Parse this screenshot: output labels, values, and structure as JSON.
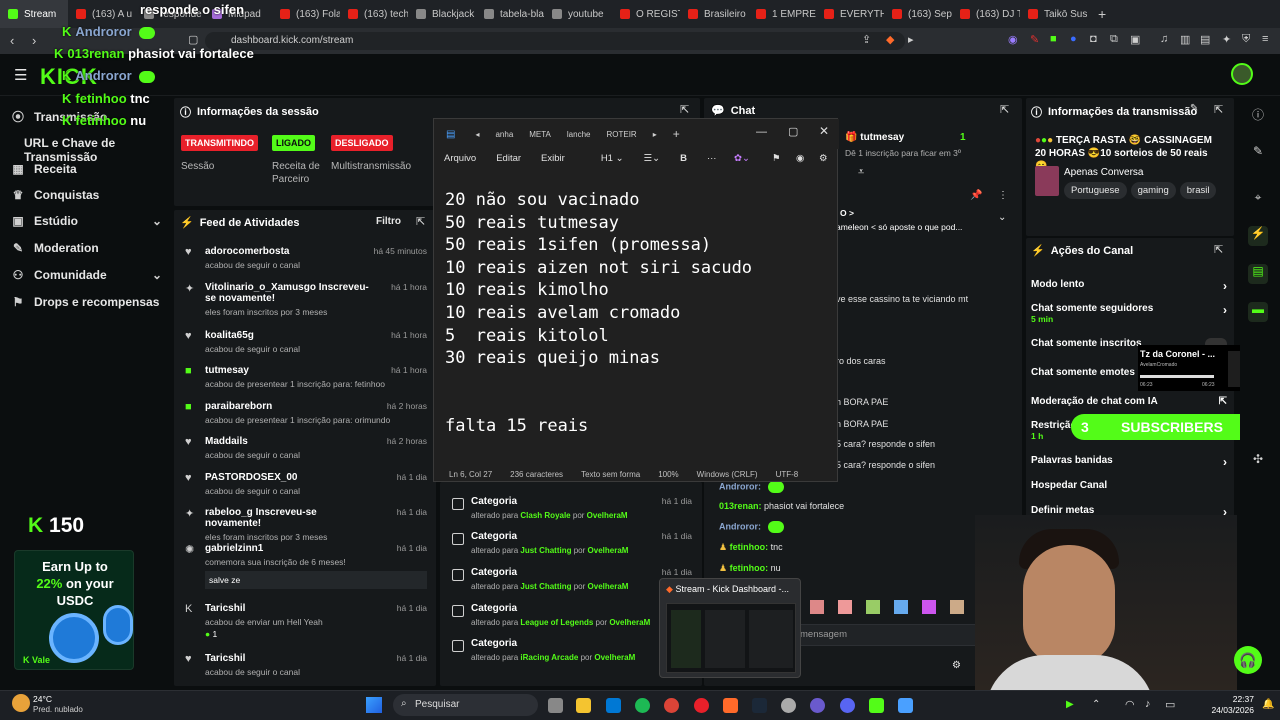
{
  "browser": {
    "tabs": [
      {
        "label": "Stream",
        "fav": "kick",
        "active": true
      },
      {
        "label": "(163) A u",
        "fav": "yt"
      },
      {
        "label": "responde o sifen",
        "fav": "g"
      },
      {
        "label": "Midpad",
        "fav": "p"
      },
      {
        "label": "(163) Fola",
        "fav": "yt"
      },
      {
        "label": "(163) tech",
        "fav": "yt"
      },
      {
        "label": "Blackjack",
        "fav": "g"
      },
      {
        "label": "tabela-bla",
        "fav": "g"
      },
      {
        "label": "youtube",
        "fav": "g"
      },
      {
        "label": "O REGISTI",
        "fav": "yt"
      },
      {
        "label": "Brasileiro",
        "fav": "yt"
      },
      {
        "label": "1 EMPREE",
        "fav": "yt"
      },
      {
        "label": "EVERYTHI",
        "fav": "yt"
      },
      {
        "label": "(163) Sep",
        "fav": "yt"
      },
      {
        "label": "(163) DJ T",
        "fav": "yt"
      },
      {
        "label": "Taikō Susi",
        "fav": "yt"
      }
    ],
    "url": "dashboard.kick.com/stream"
  },
  "overlay_chat": [
    {
      "name": "",
      "text": "responde o sifen"
    },
    {
      "name": "Androror",
      "text": ""
    },
    {
      "name": "013renan",
      "text": "phasiot vai fortalece"
    },
    {
      "name": "Androror",
      "text": ""
    },
    {
      "name": "fetinhoo",
      "text": "tnc"
    },
    {
      "name": "fetinhoo",
      "text": "nu"
    }
  ],
  "header": {
    "logo": "KICK"
  },
  "sidebar": {
    "items": [
      {
        "label": "Transmissão",
        "icon": "broadcast-icon"
      },
      {
        "label": "URL e Chave de Transmissão",
        "icon": ""
      },
      {
        "label": "Receita",
        "icon": "chart-icon"
      },
      {
        "label": "Conquistas",
        "icon": "trophy-icon"
      },
      {
        "label": "Estúdio",
        "icon": "studio-icon",
        "chevron": true
      },
      {
        "label": "Moderation",
        "icon": "wrench-icon"
      },
      {
        "label": "Comunidade",
        "icon": "community-icon",
        "chevron": true
      },
      {
        "label": "Drops e recompensas",
        "icon": "gift-icon"
      }
    ],
    "points": "150",
    "promo": {
      "l1": "Earn Up to",
      "l2": "22%",
      "l3": "on your",
      "l4": "USDC",
      "vale": "Vale"
    }
  },
  "session": {
    "title": "Informações da sessão",
    "statuses": [
      {
        "badge": "TRANSMITINDO",
        "label": "Sessão",
        "color": "#e8202a"
      },
      {
        "badge": "LIGADO",
        "label": "Receita de Parceiro",
        "color": "#53fc18"
      },
      {
        "badge": "DESLIGADO",
        "label": "Multistransmissão",
        "color": "#e8202a"
      }
    ]
  },
  "feed": {
    "title": "Feed de Atividades",
    "filter": "Filtro",
    "items": [
      {
        "name": "adorocomerbosta",
        "desc": "acabou de seguir o canal",
        "time": "há 45 minutos",
        "icon": "heart-icon"
      },
      {
        "name": "Vitolinario_o_Xamusgo Inscreveu-se novamente!",
        "desc": "eles foram inscritos por 3 meses",
        "time": "há 1 hora",
        "icon": "star-icon"
      },
      {
        "name": "koalita65g",
        "desc": "acabou de seguir o canal",
        "time": "há 1 hora",
        "icon": "heart-icon"
      },
      {
        "name": "tutmesay",
        "desc": "acabou de presentear 1 inscrição para: fetinhoo",
        "time": "há 1 hora",
        "icon": "gift-icon"
      },
      {
        "name": "paraibareborn",
        "desc": "acabou de presentear 1 inscrição para: orimundo",
        "time": "há 2 horas",
        "icon": "gift-icon"
      },
      {
        "name": "Maddails",
        "desc": "acabou de seguir o canal",
        "time": "há 2 horas",
        "icon": "heart-icon"
      },
      {
        "name": "PASTORDOSEX_00",
        "desc": "acabou de seguir o canal",
        "time": "há 1 dia",
        "icon": "heart-icon"
      },
      {
        "name": "rabeloo_g Inscreveu-se novamente!",
        "desc": "eles foram inscritos por 3 meses",
        "time": "há 1 dia",
        "icon": "star-icon"
      },
      {
        "name": "gabrielzinn1",
        "desc": "comemora sua inscrição de 6 meses!",
        "time": "há 1 dia",
        "icon": "party-icon",
        "note": "salve ze"
      },
      {
        "name": "Taricshil",
        "desc": "acabou de enviar um Hell Yeah",
        "time": "há 1 dia",
        "icon": "kick-icon",
        "extra": "1"
      },
      {
        "name": "Taricshil",
        "desc": "acabou de seguir o canal",
        "time": "há 1 dia",
        "icon": "heart-icon"
      }
    ]
  },
  "notepad": {
    "tabs": [
      "anha",
      "META",
      "lanche",
      "ROTEIR"
    ],
    "menu": [
      "Arquivo",
      "Editar",
      "Exibir"
    ],
    "heading": "H1",
    "lines": [
      "20 não sou vacinado",
      "50 reais tutmesay",
      "50 reais 1sifen (promessa)",
      "10 reais aizen not siri sacudo",
      "10 reais kimolho",
      "10 reais avelam cromado",
      "5  reais kitolol",
      "30 reais queijo minas",
      "",
      "",
      "falta 15 reais"
    ],
    "status": [
      "Ln 6, Col 27",
      "236 caracteres",
      "Texto sem forma",
      "100%",
      "Windows (CRLF)",
      "UTF-8"
    ]
  },
  "categories": [
    {
      "title": "Categoria",
      "game": "Clash Royale",
      "by": "OvelheraM",
      "time": "há 1 dia"
    },
    {
      "title": "Categoria",
      "game": "Just Chatting",
      "by": "OvelheraM",
      "time": "há 1 dia"
    },
    {
      "title": "Categoria",
      "game": "Just Chatting",
      "by": "OvelheraM",
      "time": "há 1 dia"
    },
    {
      "title": "Categoria",
      "game": "League of Legends",
      "by": "OvelheraM",
      "time": "há 1 dia"
    },
    {
      "title": "Categoria",
      "game": "iRacing Arcade",
      "by": "OvelheraM",
      "time": "há 1 dia"
    }
  ],
  "category_sub_prefix": "alterado para",
  "category_by_prefix": "por",
  "chat": {
    "title": "Chat",
    "top_user": "tutmesay",
    "top_user_count": "1",
    "top_sub": "Dê 1 inscrição para ficar em 3º",
    "pinned": "ameleon < só aposte o que pod...",
    "lines": [
      {
        "name": "",
        "text": "ve esse cassino ta te viciando mt"
      },
      {
        "name": "",
        "text": "ro dos caras"
      },
      {
        "name": "",
        "text": "n BORA PAE"
      },
      {
        "name": "",
        "text": "n BORA PAE"
      },
      {
        "name": "",
        "text": "5 cara? responde o sifen"
      },
      {
        "name": "",
        "text": "5 cara? responde o sifen"
      },
      {
        "name": "Androror:",
        "text": ""
      },
      {
        "name": "013renan:",
        "text": "phasiot vai fortalece"
      },
      {
        "name": "Androror:",
        "text": ""
      },
      {
        "name": "fetinhoo:",
        "text": "tnc"
      },
      {
        "name": "fetinhoo:",
        "text": "nu"
      }
    ],
    "input_placeholder": "mensagem",
    "popup": "Stream - Kick Dashboard -..."
  },
  "stream_info": {
    "title": "Informações da transmissão",
    "desc": "TERÇA RASTA 🤓 CASSINAGEM 20 HORAS 😎10 sorteios de 50 reais 😊...",
    "category": "Apenas Conversa",
    "tags": [
      "Portuguese",
      "gaming",
      "brasil"
    ]
  },
  "channel_actions": {
    "title": "Ações do Canal",
    "rows": [
      {
        "label": "Modo lento",
        "sub": "",
        "arrow": "›"
      },
      {
        "label": "Chat somente seguidores",
        "sub": "5 min",
        "arrow": "›"
      },
      {
        "label": "Chat somente inscritos",
        "sub": "",
        "arrow": ""
      },
      {
        "label": "Chat somente emotes",
        "sub": "",
        "arrow": ""
      },
      {
        "label": "Moderação de chat com IA",
        "sub": "",
        "arrow": ""
      },
      {
        "label": "Restrição",
        "sub": "1 h",
        "arrow": ""
      },
      {
        "label": "Palavras banidas",
        "sub": "",
        "arrow": "›"
      },
      {
        "label": "Hospedar Canal",
        "sub": "",
        "arrow": ""
      },
      {
        "label": "Definir metas",
        "sub": "",
        "arrow": "›"
      }
    ],
    "music_title": "Tz da Coronel - ...",
    "music_artist": "AvelamCromado",
    "music_t1": "06:23",
    "music_t2": "06:23"
  },
  "subs_banner": {
    "left": "3",
    "label": "SUBSCRIBERS",
    "right": "2"
  },
  "taskbar": {
    "weather_temp": "24°C",
    "weather_desc": "Pred. nublado",
    "search": "Pesquisar",
    "time": "22:37",
    "date": "24/03/2026"
  }
}
